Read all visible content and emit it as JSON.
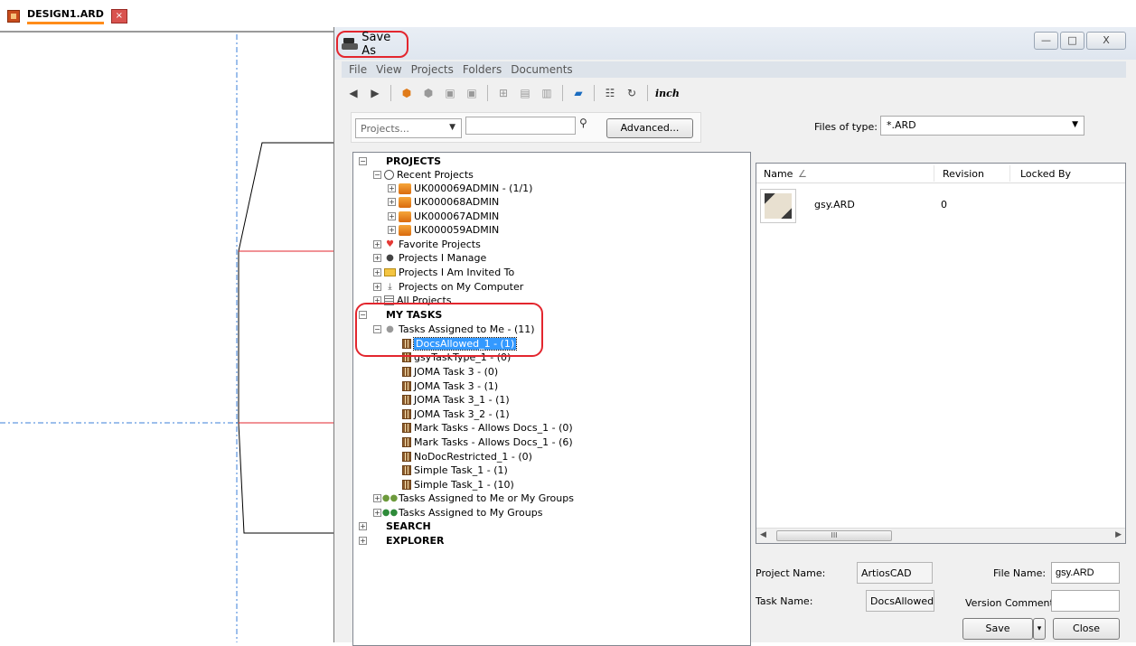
{
  "tab": {
    "title": "DESIGN1.ARD",
    "close": "×"
  },
  "dialog": {
    "title": "Save As",
    "window_buttons": {
      "minimize": "—",
      "maximize": "□",
      "close": "X"
    }
  },
  "menu": [
    "File",
    "View",
    "Projects",
    "Folders",
    "Documents"
  ],
  "toolbar": {
    "inch_label": "inch"
  },
  "search": {
    "projects_select": "Projects...",
    "query": "",
    "advanced_label": "Advanced..."
  },
  "files_of_type": {
    "label": "Files of type:",
    "value": "*.ARD"
  },
  "tree": {
    "projects_header": "PROJECTS",
    "recent_projects": "Recent Projects",
    "recent_items": [
      "UK000069ADMIN - (1/1)",
      "UK000068ADMIN",
      "UK000067ADMIN",
      "UK000059ADMIN"
    ],
    "favorite_projects": "Favorite Projects",
    "projects_i_manage": "Projects I Manage",
    "projects_invited": "Projects I Am Invited To",
    "projects_on_computer": "Projects on My Computer",
    "all_projects": "All Projects",
    "my_tasks_header": "MY TASKS",
    "tasks_assigned_to_me": "Tasks Assigned to Me - (11)",
    "task_items": [
      "DocsAllowed_1 - (1)",
      "gsyTaskType_1 - (0)",
      "JOMA Task 3 - (0)",
      "JOMA Task 3 - (1)",
      "JOMA Task 3_1 - (1)",
      "JOMA Task 3_2 - (1)",
      "Mark Tasks - Allows Docs_1 - (0)",
      "Mark Tasks - Allows Docs_1 - (6)",
      "NoDocRestricted_1 - (0)",
      "Simple Task_1 - (1)",
      "Simple Task_1 - (10)"
    ],
    "tasks_me_or_groups": "Tasks Assigned to Me or My Groups",
    "tasks_my_groups": "Tasks Assigned to My Groups",
    "search_header": "SEARCH",
    "explorer_header": "EXPLORER"
  },
  "file_list": {
    "columns": {
      "name": "Name",
      "sort": "∠",
      "revision": "Revision",
      "locked_by": "Locked By"
    },
    "rows": [
      {
        "name": "gsy.ARD",
        "revision": "0",
        "locked_by": ""
      }
    ],
    "scroll_grip": "III"
  },
  "details": {
    "project_name_label": "Project Name:",
    "project_name_value": "ArtiosCAD",
    "task_name_label": "Task Name:",
    "task_name_value": "DocsAllowed_",
    "file_name_label": "File Name:",
    "file_name_value": "gsy.ARD",
    "version_comment_label": "Version Comment:",
    "version_comment_value": ""
  },
  "buttons": {
    "save": "Save",
    "save_dropdown": "▾",
    "close": "Close"
  }
}
